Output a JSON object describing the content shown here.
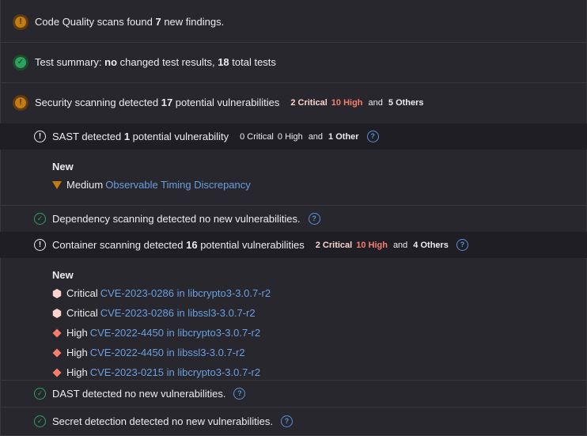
{
  "code_quality": {
    "pre": "Code Quality scans found ",
    "count": "7",
    "post": " new findings."
  },
  "test_summary": {
    "pre": "Test summary: ",
    "changed": "no",
    "mid": " changed test results, ",
    "total": "18",
    "post": " total tests"
  },
  "security": {
    "pre": "Security scanning detected ",
    "count": "17",
    "post": " potential vulnerabilities",
    "critical": "2 Critical",
    "high": "10 High",
    "and": "and",
    "others": "5 Others"
  },
  "sast": {
    "pre": "SAST detected ",
    "count": "1",
    "post": " potential vulnerability",
    "critical": "0 Critical",
    "high": "0 High",
    "and": "and",
    "others": "1 Other",
    "new_label": "New",
    "findings": [
      {
        "severity": "Medium",
        "title": "Observable Timing Discrepancy",
        "icon": "medium-severity-icon"
      }
    ]
  },
  "dependency": {
    "text": "Dependency scanning detected no new vulnerabilities."
  },
  "container": {
    "pre": "Container scanning detected ",
    "count": "16",
    "post": " potential vulnerabilities",
    "critical": "2 Critical",
    "high": "10 High",
    "and": "and",
    "others": "4 Others",
    "new_label": "New",
    "findings": [
      {
        "severity": "Critical",
        "title": "CVE-2023-0286 in libcrypto3-3.0.7-r2",
        "icon": "critical-severity-icon"
      },
      {
        "severity": "Critical",
        "title": "CVE-2023-0286 in libssl3-3.0.7-r2",
        "icon": "critical-severity-icon"
      },
      {
        "severity": "High",
        "title": "CVE-2022-4450 in libcrypto3-3.0.7-r2",
        "icon": "high-severity-icon"
      },
      {
        "severity": "High",
        "title": "CVE-2022-4450 in libssl3-3.0.7-r2",
        "icon": "high-severity-icon"
      },
      {
        "severity": "High",
        "title": "CVE-2023-0215 in libcrypto3-3.0.7-r2",
        "icon": "high-severity-icon"
      }
    ]
  },
  "dast": {
    "text": "DAST detected no new vulnerabilities."
  },
  "secret": {
    "text": "Secret detection detected no new vulnerabilities."
  },
  "colors": {
    "background": "#28272d",
    "subheader": "#1f1e24",
    "link": "#6a9fe0",
    "critical": "#fdd4cd",
    "high": "#f57f6c",
    "medium": "#c17d10",
    "success": "#2da160",
    "warning": "#c17d10"
  }
}
